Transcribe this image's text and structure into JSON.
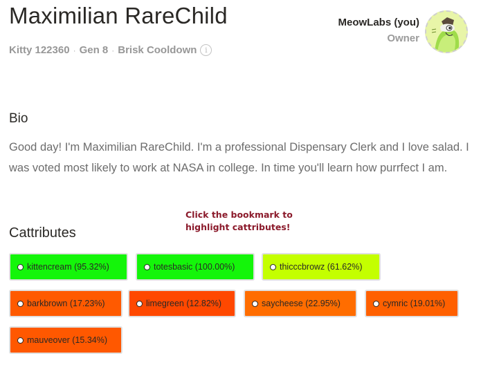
{
  "kitty": {
    "name": "Maximilian RareChild",
    "id_label": "Kitty 122360",
    "generation": "Gen 8",
    "cooldown": "Brisk Cooldown",
    "info_glyph": "i"
  },
  "owner": {
    "name": "MeowLabs (you)",
    "role": "Owner",
    "avatar_icon": "cat-avatar-icon"
  },
  "bio": {
    "heading": "Bio",
    "text": "Good day! I'm Maximilian RareChild. I'm a professional Dispensary Clerk and I love salad. I was voted most likely to work at NASA in college. In time you'll learn how purrfect I am."
  },
  "hint": {
    "line1": "Click the bookmark to",
    "line2": "highlight cattributes!"
  },
  "cattributes": {
    "heading": "Cattributes",
    "items": [
      {
        "label": "kittencream (95.32%)",
        "color": "#14f50a"
      },
      {
        "label": "totesbasic (100.00%)",
        "color": "#14f50a"
      },
      {
        "label": "thicccbrowz (61.62%)",
        "color": "#c4ff00"
      },
      {
        "label": "barkbrown (17.23%)",
        "color": "#ff5a00"
      },
      {
        "label": "limegreen (12.82%)",
        "color": "#ff4800"
      },
      {
        "label": "saycheese (22.95%)",
        "color": "#ff6d00"
      },
      {
        "label": "cymric (19.01%)",
        "color": "#ff6000"
      },
      {
        "label": "mauveover (15.34%)",
        "color": "#ff5800"
      }
    ]
  }
}
